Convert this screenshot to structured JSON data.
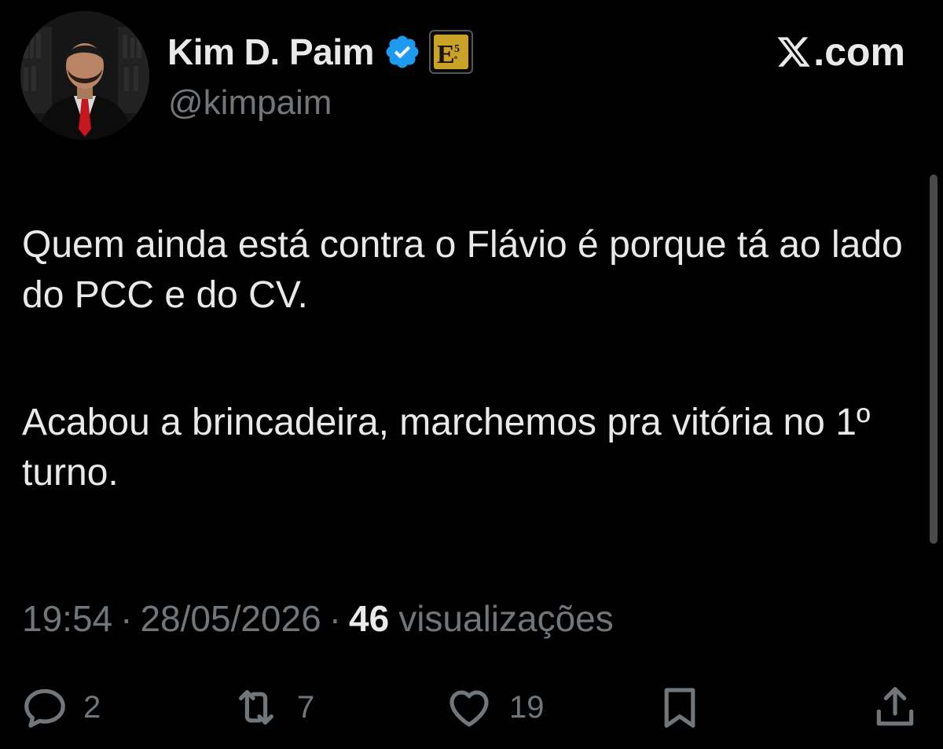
{
  "brand": {
    "label": ".com",
    "icon": "x-logo-icon"
  },
  "author": {
    "display_name": "Kim D. Paim",
    "handle": "@kimpaim",
    "avatar_icon": "avatar",
    "verified_icon": "verified-badge-icon",
    "affiliate_icon": "affiliate-badge-icon",
    "affiliate_badge_text": "E5º"
  },
  "tweet": {
    "paragraphs": [
      "Quem ainda está contra o Flávio é porque tá ao lado do PCC e do CV.",
      "Acabou a brincadeira, marchemos pra vitória no 1º turno."
    ]
  },
  "meta": {
    "time": "19:54",
    "date": "28/05/2026",
    "separator": "·",
    "views_count": "46",
    "views_label": "visualizações"
  },
  "actions": {
    "replies": {
      "icon": "reply-icon",
      "count": "2"
    },
    "retweets": {
      "icon": "retweet-icon",
      "count": "7"
    },
    "likes": {
      "icon": "like-icon",
      "count": "19"
    },
    "bookmark": {
      "icon": "bookmark-icon"
    },
    "share": {
      "icon": "share-icon"
    }
  },
  "colors": {
    "background": "#000000",
    "primary_text": "#e7e9ea",
    "secondary_text": "#71767b",
    "verified": "#1d9bf0",
    "affiliate_gold": "#c9a227"
  }
}
